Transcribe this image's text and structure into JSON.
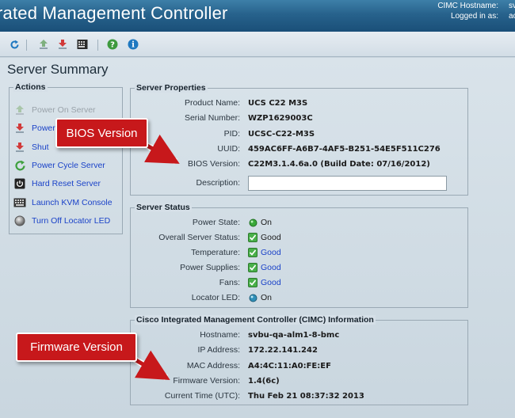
{
  "header": {
    "title": "rated Management Controller",
    "hostname_label": "CIMC Hostname:",
    "hostname_value": "sv",
    "logged_label": "Logged in as:",
    "logged_value": "ac"
  },
  "toolbar": {
    "icons": [
      "refresh-icon",
      "upload-icon",
      "download-icon",
      "keyboard-icon",
      "help-icon",
      "info-icon"
    ]
  },
  "page": {
    "title": "Server Summary"
  },
  "actions": {
    "legend": "Actions",
    "items": [
      {
        "label": "Power On Server",
        "icon": "power-on-icon",
        "enabled": false
      },
      {
        "label": "Power",
        "icon": "power-off-icon",
        "enabled": true
      },
      {
        "label": "Shut",
        "icon": "shutdown-icon",
        "enabled": true
      },
      {
        "label": "Power Cycle Server",
        "icon": "power-cycle-icon",
        "enabled": true
      },
      {
        "label": "Hard Reset Server",
        "icon": "hard-reset-icon",
        "enabled": true
      },
      {
        "label": "Launch KVM Console",
        "icon": "kvm-icon",
        "enabled": true
      },
      {
        "label": "Turn Off Locator LED",
        "icon": "locator-led-icon",
        "enabled": true
      }
    ]
  },
  "server_properties": {
    "legend": "Server Properties",
    "rows": [
      {
        "label": "Product Name:",
        "value": "UCS C22 M3S"
      },
      {
        "label": "Serial Number:",
        "value": "WZP1629003C"
      },
      {
        "label": "PID:",
        "value": "UCSC-C22-M3S"
      },
      {
        "label": "UUID:",
        "value": "459AC6FF-A6B7-4AF5-B251-54E5F511C276"
      },
      {
        "label": "BIOS Version:",
        "value": "C22M3.1.4.6a.0 (Build Date: 07/16/2012)"
      }
    ],
    "description_label": "Description:",
    "description_value": ""
  },
  "server_status": {
    "legend": "Server Status",
    "rows": [
      {
        "label": "Power State:",
        "value": "On",
        "icon": "green-dot",
        "link": false
      },
      {
        "label": "Overall Server Status:",
        "value": "Good",
        "icon": "check",
        "link": false
      },
      {
        "label": "Temperature:",
        "value": "Good",
        "icon": "check",
        "link": true
      },
      {
        "label": "Power Supplies:",
        "value": "Good",
        "icon": "check",
        "link": true
      },
      {
        "label": "Fans:",
        "value": "Good",
        "icon": "check",
        "link": true
      },
      {
        "label": "Locator LED:",
        "value": "On",
        "icon": "blue-dot",
        "link": false
      }
    ]
  },
  "cimc_info": {
    "legend": "Cisco Integrated Management Controller (CIMC) Information",
    "rows": [
      {
        "label": "Hostname:",
        "value": "svbu-qa-alm1-8-bmc"
      },
      {
        "label": "IP Address:",
        "value": "172.22.141.242"
      },
      {
        "label": "MAC Address:",
        "value": "A4:4C:11:A0:FE:EF"
      },
      {
        "label": "Firmware Version:",
        "value": "1.4(6c)"
      },
      {
        "label": "Current Time (UTC):",
        "value": "Thu Feb 21 08:37:32 2013"
      }
    ]
  },
  "callouts": {
    "bios": "BIOS Version",
    "firmware": "Firmware Version"
  },
  "colors": {
    "header_blue": "#27628c",
    "link_blue": "#1a42c8",
    "callout_red": "#c7181b",
    "status_green": "#3aa83a"
  }
}
